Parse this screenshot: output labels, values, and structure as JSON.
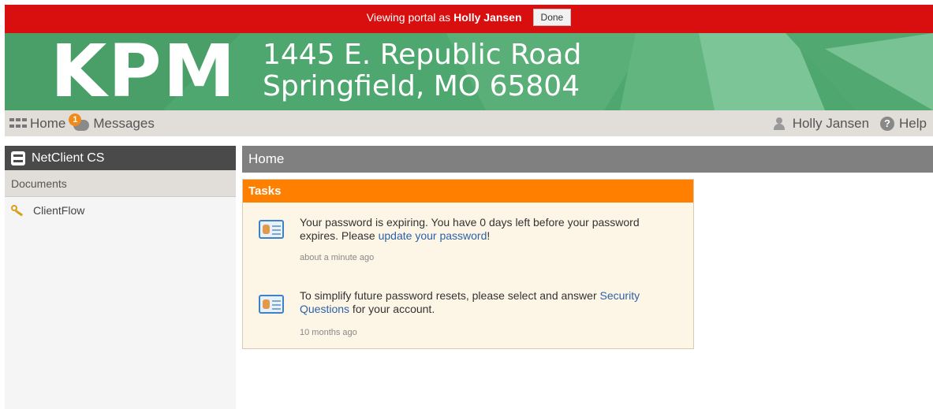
{
  "impersonation": {
    "prefix": "Viewing portal as",
    "user": "Holly Jansen",
    "done_label": "Done"
  },
  "banner": {
    "logo": "KPM",
    "address_line1": "1445 E. Republic Road",
    "address_line2": "Springfield, MO 65804",
    "colors": {
      "base": "#4fa770",
      "light": "#6cbf89",
      "dark": "#3c8f5c"
    }
  },
  "nav": {
    "home_label": "Home",
    "messages_label": "Messages",
    "messages_badge": "1",
    "user_label": "Holly Jansen",
    "help_label": "Help",
    "help_icon_glyph": "?"
  },
  "sidebar": {
    "title": "NetClient CS",
    "section": "Documents",
    "items": [
      {
        "label": "ClientFlow",
        "icon": "key-icon"
      }
    ]
  },
  "main": {
    "title": "Home",
    "tasks_title": "Tasks",
    "tasks": [
      {
        "text_before": "Your password is expiring. You have 0 days left before your password expires. Please ",
        "link": "update your password",
        "text_after": "!",
        "time": "about a minute ago"
      },
      {
        "text_before": "To simplify future password resets, please select and answer ",
        "link": "Security Questions",
        "text_after": " for your account.",
        "time": "10 months ago"
      }
    ]
  },
  "colors": {
    "alert_red": "#d90e0e",
    "tasks_orange": "#ff7f00",
    "link_blue": "#2b62a8"
  }
}
